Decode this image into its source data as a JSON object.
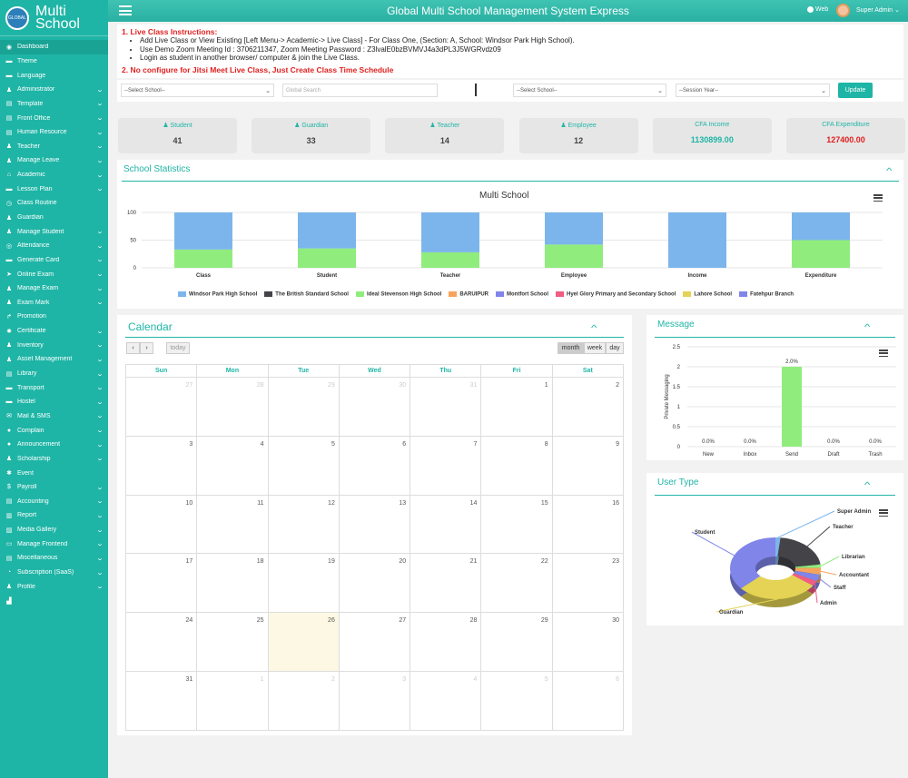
{
  "app": {
    "title": "Global Multi School Management System Express",
    "logo_line1": "Multi",
    "logo_line2": "School",
    "logo_badge": "GLOBAL",
    "web_label": "Web",
    "user_name": "Super Admin"
  },
  "sidebar": {
    "items": [
      {
        "label": "Dashboard",
        "icon": "dashboard-icon",
        "chevron": false
      },
      {
        "label": "Theme",
        "icon": "theme-icon",
        "chevron": false
      },
      {
        "label": "Language",
        "icon": "language-icon",
        "chevron": false
      },
      {
        "label": "Administrator",
        "icon": "admin-icon",
        "chevron": true
      },
      {
        "label": "Template",
        "icon": "template-icon",
        "chevron": true
      },
      {
        "label": "Front Office",
        "icon": "front-office-icon",
        "chevron": true
      },
      {
        "label": "Human Resource",
        "icon": "human-resource-icon",
        "chevron": true
      },
      {
        "label": "Teacher",
        "icon": "teacher-icon",
        "chevron": true
      },
      {
        "label": "Manage Leave",
        "icon": "leave-icon",
        "chevron": true
      },
      {
        "label": "Academic",
        "icon": "academic-icon",
        "chevron": true
      },
      {
        "label": "Lesson Plan",
        "icon": "lesson-plan-icon",
        "chevron": true
      },
      {
        "label": "Class Routine",
        "icon": "routine-icon",
        "chevron": false
      },
      {
        "label": "Guardian",
        "icon": "guardian-icon",
        "chevron": false
      },
      {
        "label": "Manage Student",
        "icon": "student-icon",
        "chevron": true
      },
      {
        "label": "Attendance",
        "icon": "attendance-icon",
        "chevron": true
      },
      {
        "label": "Generate Card",
        "icon": "card-icon",
        "chevron": true
      },
      {
        "label": "Online Exam",
        "icon": "online-exam-icon",
        "chevron": true
      },
      {
        "label": "Manage Exam",
        "icon": "exam-icon",
        "chevron": true
      },
      {
        "label": "Exam Mark",
        "icon": "exam-mark-icon",
        "chevron": true
      },
      {
        "label": "Promotion",
        "icon": "promotion-icon",
        "chevron": false
      },
      {
        "label": "Certificate",
        "icon": "certificate-icon",
        "chevron": true
      },
      {
        "label": "Inventory",
        "icon": "inventory-icon",
        "chevron": true
      },
      {
        "label": "Asset Management",
        "icon": "asset-icon",
        "chevron": true
      },
      {
        "label": "Library",
        "icon": "library-icon",
        "chevron": true
      },
      {
        "label": "Transport",
        "icon": "transport-icon",
        "chevron": true
      },
      {
        "label": "Hostel",
        "icon": "hostel-icon",
        "chevron": true
      },
      {
        "label": "Mail & SMS",
        "icon": "mail-icon",
        "chevron": true
      },
      {
        "label": "Complain",
        "icon": "complain-icon",
        "chevron": true
      },
      {
        "label": "Announcement",
        "icon": "announcement-icon",
        "chevron": true
      },
      {
        "label": "Scholarship",
        "icon": "scholarship-icon",
        "chevron": true
      },
      {
        "label": "Event",
        "icon": "event-icon",
        "chevron": false
      },
      {
        "label": "Payroll",
        "icon": "payroll-icon",
        "chevron": true
      },
      {
        "label": "Accounting",
        "icon": "accounting-icon",
        "chevron": true
      },
      {
        "label": "Report",
        "icon": "report-icon",
        "chevron": true
      },
      {
        "label": "Media Gallery",
        "icon": "gallery-icon",
        "chevron": true
      },
      {
        "label": "Manage Frontend",
        "icon": "frontend-icon",
        "chevron": true
      },
      {
        "label": "Miscellaneous",
        "icon": "misc-icon",
        "chevron": true
      },
      {
        "label": "Subscription (SaaS)",
        "icon": "subscription-icon",
        "chevron": true
      },
      {
        "label": "Profile",
        "icon": "profile-icon",
        "chevron": true
      },
      {
        "label": "",
        "icon": "signal-icon",
        "chevron": false
      }
    ]
  },
  "instructions": {
    "title": "1. Live Class Instructions:",
    "items": [
      "Add Live Class or View Existing [Left Menu-> Academic-> Live Class] - For Class One, (Section: A, School: Windsor Park High School).",
      "Use Demo Zoom Meeting Id : 3706211347, Zoom Meeting Password : Z3lvalE0bzBVMVJ4a3dPL3J5WGRvdz09",
      "Login as student in another browser/ computer & join the Live Class."
    ],
    "note": "2. No configure for Jitsi Meet Live Class, Just Create Class Time Schedule"
  },
  "filters": {
    "school_select": "--Select School--",
    "search_placeholder": "Global Search",
    "school_select2": "--Select School--",
    "year_select": "--Session Year--",
    "update_label": "Update"
  },
  "stats": [
    {
      "label": "Student",
      "value": "41",
      "color": "#444444"
    },
    {
      "label": "Guardian",
      "value": "33",
      "color": "#444444"
    },
    {
      "label": "Teacher",
      "value": "14",
      "color": "#444444"
    },
    {
      "label": "Employee",
      "value": "12",
      "color": "#444444"
    },
    {
      "label": "CFA Income",
      "value": "1130899.00",
      "color": "#1fb5a6"
    },
    {
      "label": "CFA Expenditure",
      "value": "127400.00",
      "color": "#e02020"
    }
  ],
  "school_stats": {
    "panel_title": "School Statistics"
  },
  "calendar": {
    "title": "Calendar",
    "prev": "‹",
    "next": "›",
    "today_btn": "today",
    "views": [
      "month",
      "week",
      "day"
    ],
    "days": [
      "Sun",
      "Mon",
      "Tue",
      "Wed",
      "Thu",
      "Fri",
      "Sat"
    ],
    "weeks": [
      [
        {
          "d": "27",
          "o": true
        },
        {
          "d": "28",
          "o": true
        },
        {
          "d": "29",
          "o": true
        },
        {
          "d": "30",
          "o": true
        },
        {
          "d": "31",
          "o": true
        },
        {
          "d": "1"
        },
        {
          "d": "2"
        }
      ],
      [
        {
          "d": "3"
        },
        {
          "d": "4"
        },
        {
          "d": "5"
        },
        {
          "d": "6"
        },
        {
          "d": "7"
        },
        {
          "d": "8"
        },
        {
          "d": "9"
        }
      ],
      [
        {
          "d": "10"
        },
        {
          "d": "11"
        },
        {
          "d": "12"
        },
        {
          "d": "13"
        },
        {
          "d": "14"
        },
        {
          "d": "15"
        },
        {
          "d": "16"
        }
      ],
      [
        {
          "d": "17"
        },
        {
          "d": "18"
        },
        {
          "d": "19"
        },
        {
          "d": "20"
        },
        {
          "d": "21"
        },
        {
          "d": "22"
        },
        {
          "d": "23"
        }
      ],
      [
        {
          "d": "24"
        },
        {
          "d": "25"
        },
        {
          "d": "26",
          "t": true
        },
        {
          "d": "27"
        },
        {
          "d": "28"
        },
        {
          "d": "29"
        },
        {
          "d": "30"
        }
      ],
      [
        {
          "d": "31"
        },
        {
          "d": "1",
          "o": true
        },
        {
          "d": "2",
          "o": true
        },
        {
          "d": "3",
          "o": true
        },
        {
          "d": "4",
          "o": true
        },
        {
          "d": "5",
          "o": true
        },
        {
          "d": "6",
          "o": true
        }
      ]
    ]
  },
  "message": {
    "panel_title": "Message"
  },
  "user_type": {
    "panel_title": "User Type"
  },
  "chart_data": [
    {
      "type": "bar",
      "title": "Multi School",
      "stacked": true,
      "percent": true,
      "categories": [
        "Class",
        "Student",
        "Teacher",
        "Employee",
        "Income",
        "Expenditure"
      ],
      "ylim": [
        0,
        100
      ],
      "yticks": [
        0,
        50,
        100
      ],
      "series": [
        {
          "name": "Windsor Park High School",
          "color": "#7cb5ec",
          "values": [
            67,
            65,
            72,
            58,
            100,
            50
          ]
        },
        {
          "name": "The British Standard School",
          "color": "#434348",
          "values": [
            0,
            0,
            0,
            0,
            0,
            0
          ]
        },
        {
          "name": "Ideal Stevenson High School",
          "color": "#90ed7d",
          "values": [
            33,
            35,
            28,
            42,
            0,
            50
          ]
        },
        {
          "name": "BARUIPUR",
          "color": "#f7a35c",
          "values": [
            0,
            0,
            0,
            0,
            0,
            0
          ]
        },
        {
          "name": "Montfort School",
          "color": "#8085e9",
          "values": [
            0,
            0,
            0,
            0,
            0,
            0
          ]
        },
        {
          "name": "Hyel Glory Primary and Secondary School",
          "color": "#f15c80",
          "values": [
            0,
            0,
            0,
            0,
            0,
            0
          ]
        },
        {
          "name": "Lahore School",
          "color": "#e4d354",
          "values": [
            0,
            0,
            0,
            0,
            0,
            0
          ]
        },
        {
          "name": "Fatehpur Branch",
          "color": "#8085e9",
          "values": [
            0,
            0,
            0,
            0,
            0,
            0
          ]
        }
      ]
    },
    {
      "type": "bar",
      "ylabel": "Private Messaging",
      "categories": [
        "New",
        "Inbox",
        "Send",
        "Draft",
        "Trash"
      ],
      "values": [
        0,
        0,
        2,
        0,
        0
      ],
      "labels": [
        "0.0%",
        "0.0%",
        "2.0%",
        "0.0%",
        "0.0%"
      ],
      "ylim": [
        0,
        2.5
      ],
      "yticks": [
        0,
        0.5,
        1,
        1.5,
        2,
        2.5
      ],
      "color": "#90ed7d"
    },
    {
      "type": "pie",
      "donut": true,
      "slices": [
        {
          "name": "Super Admin",
          "value": 2,
          "color": "#7cb5ec"
        },
        {
          "name": "Teacher",
          "value": 24,
          "color": "#434348"
        },
        {
          "name": "Librarian",
          "value": 2,
          "color": "#90ed7d"
        },
        {
          "name": "Accountant",
          "value": 4,
          "color": "#f7a35c"
        },
        {
          "name": "Staff",
          "value": 4,
          "color": "#8085e9"
        },
        {
          "name": "Admin",
          "value": 3,
          "color": "#f15c80"
        },
        {
          "name": "Guardian",
          "value": 33,
          "color": "#e4d354"
        },
        {
          "name": "Student",
          "value": 41,
          "color": "#8085e9"
        }
      ]
    }
  ]
}
